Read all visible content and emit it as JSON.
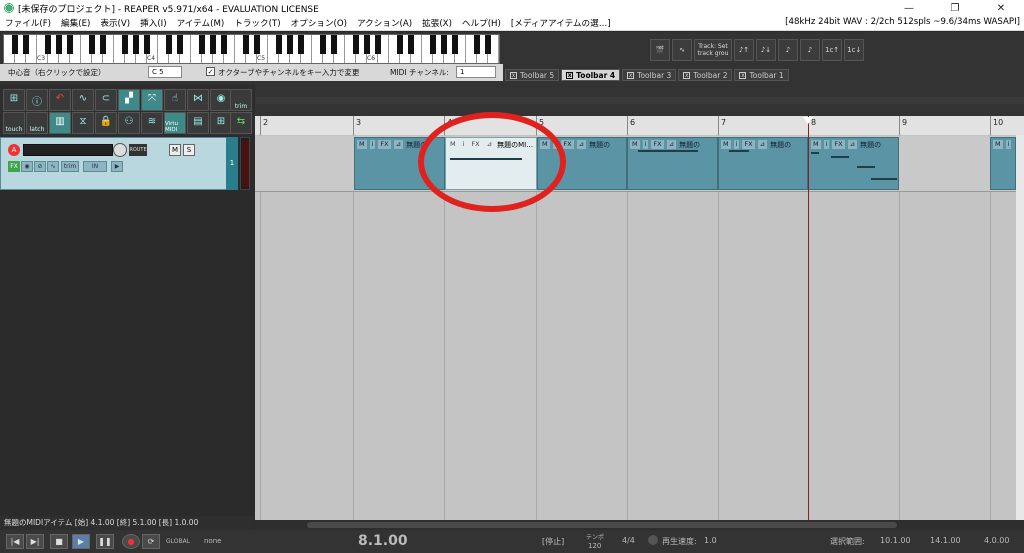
{
  "window": {
    "title": "[未保存のプロジェクト] - REAPER v5.971/x64 - EVALUATION LICENSE",
    "min": "—",
    "max": "❐",
    "close": "✕"
  },
  "menu": {
    "items": [
      "ファイル(F)",
      "編集(E)",
      "表示(V)",
      "挿入(I)",
      "アイテム(M)",
      "トラック(T)",
      "オプション(O)",
      "アクション(A)",
      "拡張(X)",
      "ヘルプ(H)",
      "[メディアアイテムの選…]"
    ],
    "status": "[48kHz 24bit WAV : 2/2ch 512spls ~9.6/34ms WASAPI]"
  },
  "piano": {
    "octaves": [
      "C3",
      "C4",
      "C5",
      "C6"
    ]
  },
  "midi_prefs": {
    "center_label": "中心音（右クリックで設定）",
    "center_note": "C 5",
    "octave_check": "✓",
    "octave_label": "オクターブやチャンネルをキー入力で変更",
    "channel_label": "MIDI チャンネル:",
    "channel_value": "1"
  },
  "right_toolbar": {
    "buttons": [
      "🎬",
      "∿",
      "Track: Set track grou",
      "♪↑",
      "♪↓",
      "♪",
      "♪",
      "1c↑",
      "1c↓"
    ]
  },
  "toolbar_tabs": [
    "Toolbar 5",
    "Toolbar 4",
    "Toolbar 3",
    "Toolbar 2",
    "Toolbar 1"
  ],
  "tools": {
    "labels": [
      "touch",
      "latch",
      "trim",
      "Virtu MIDI"
    ]
  },
  "track": {
    "record": "A",
    "routing": "ROUTE",
    "mute": "M",
    "solo": "S",
    "fx": "FX",
    "trim": "trim",
    "in": "IN",
    "number": "1"
  },
  "ruler": {
    "labels": [
      "2",
      "3",
      "4",
      "5",
      "6",
      "7",
      "8",
      "9",
      "10"
    ]
  },
  "items": {
    "header_m": "M",
    "header_i": "i",
    "header_fx": "FX",
    "name_short": "無題の",
    "name_selected": "無題のMI…"
  },
  "bottom": {
    "item_info": "無題のMIDIアイテム [始] 4.1.00 [終] 5.1.00 [長] 1.0.00"
  },
  "transport": {
    "prev": "|◀",
    "next": "▶|",
    "stop": "■",
    "play": "▶",
    "pause": "❚❚",
    "record": "●",
    "repeat": "⟳",
    "global": "GLOBAL",
    "none": "none",
    "position": "8.1.00",
    "state": "[停止]",
    "tempo_label": "テンポ",
    "tempo": "120",
    "meter": "4/4",
    "rate_label": "再生速度:",
    "rate": "1.0",
    "selection_label": "選択範囲:",
    "sel_start": "10.1.00",
    "sel_end": "14.1.00",
    "sel_len": "4.0.00"
  },
  "colors": {
    "item": "#5b95a5",
    "item_selected": "#e3ecef",
    "highlight_circle": "#e0221f",
    "playhead": "#8a2020"
  }
}
